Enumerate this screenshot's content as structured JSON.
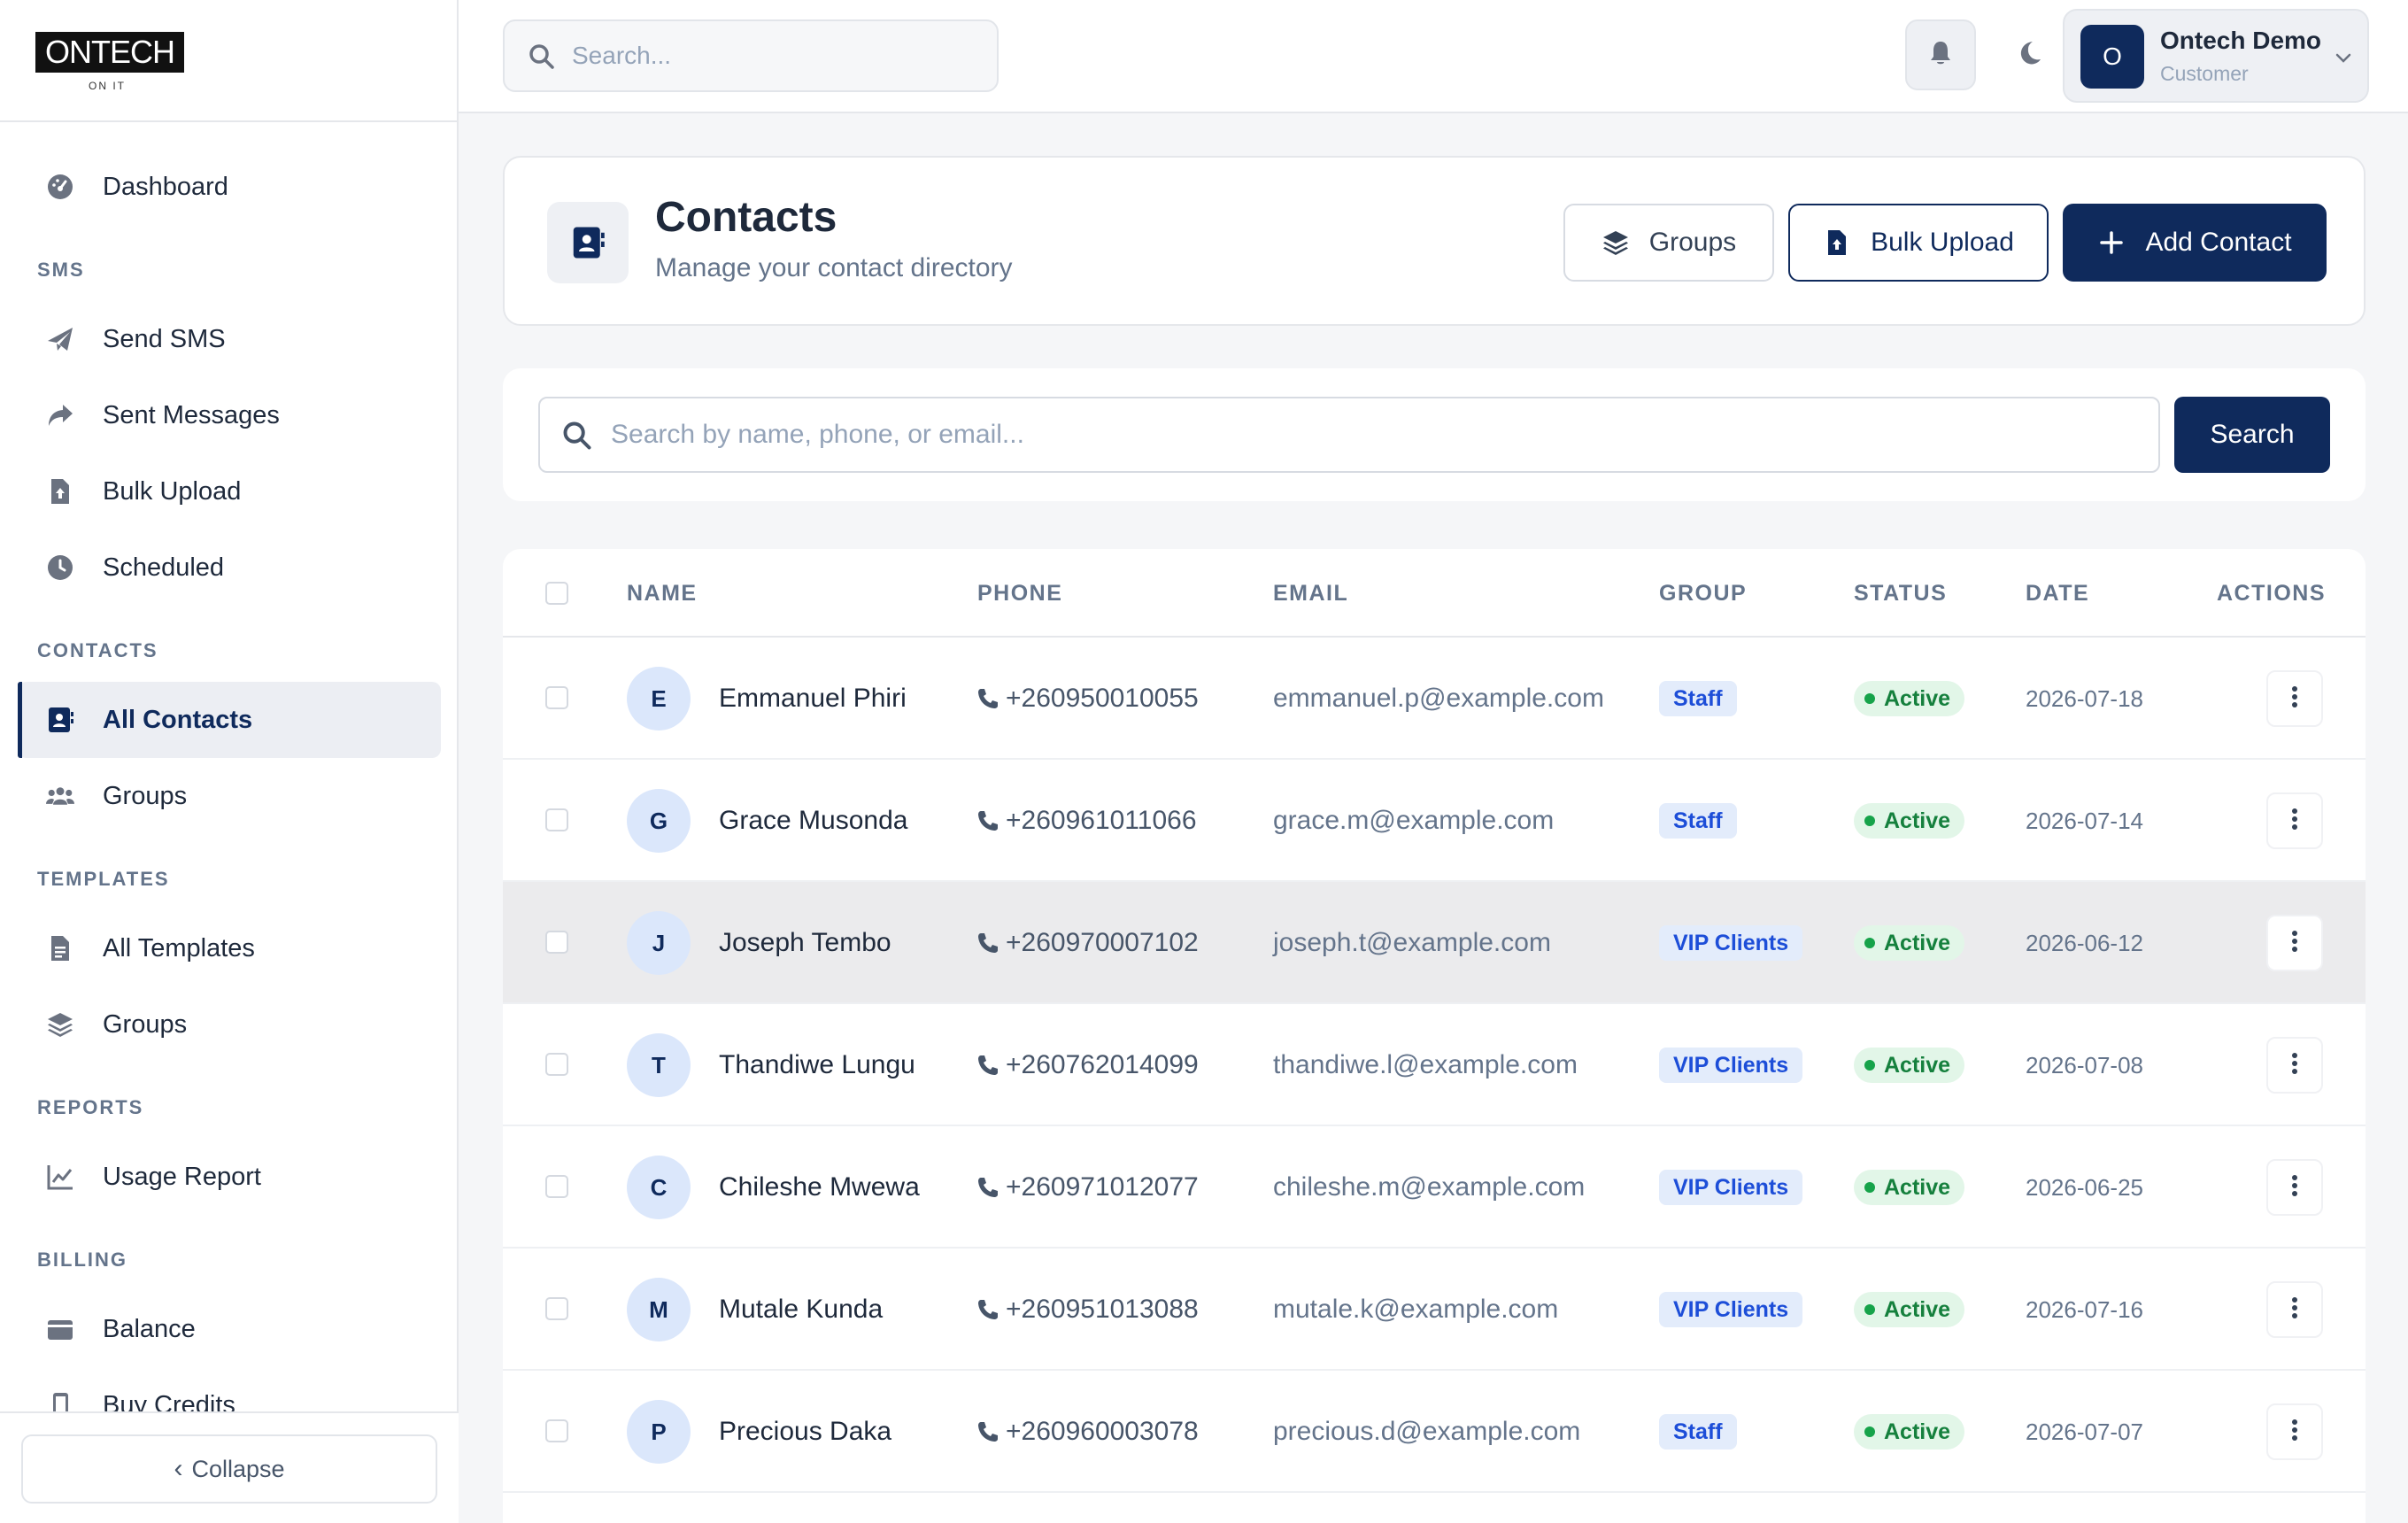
{
  "brand": {
    "logo_text": "ONTECH",
    "tagline": "ON IT"
  },
  "topbar": {
    "search_placeholder": "Search...",
    "user": {
      "initial": "O",
      "name": "Ontech Demo",
      "role": "Customer"
    }
  },
  "sidebar": {
    "dashboard": "Dashboard",
    "sections": {
      "sms": "SMS",
      "contacts": "CONTACTS",
      "templates": "TEMPLATES",
      "reports": "REPORTS",
      "billing": "BILLING"
    },
    "items": {
      "send_sms": "Send SMS",
      "sent_messages": "Sent Messages",
      "bulk_upload": "Bulk Upload",
      "scheduled": "Scheduled",
      "all_contacts": "All Contacts",
      "contact_groups": "Groups",
      "all_templates": "All Templates",
      "template_groups": "Groups",
      "usage_report": "Usage Report",
      "balance": "Balance",
      "buy_credits": "Buy Credits"
    },
    "collapse": "Collapse",
    "active": "all_contacts"
  },
  "page": {
    "title": "Contacts",
    "subtitle": "Manage your contact directory",
    "buttons": {
      "groups": "Groups",
      "bulk_upload": "Bulk Upload",
      "add_contact": "Add Contact"
    }
  },
  "search": {
    "placeholder": "Search by name, phone, or email...",
    "button": "Search"
  },
  "table": {
    "columns": {
      "name": "NAME",
      "phone": "PHONE",
      "email": "EMAIL",
      "group": "GROUP",
      "status": "STATUS",
      "date": "DATE",
      "actions": "ACTIONS"
    },
    "rows": [
      {
        "initial": "E",
        "name": "Emmanuel Phiri",
        "phone": "+260950010055",
        "email": "emmanuel.p@example.com",
        "group": "Staff",
        "status": "Active",
        "date": "2026-07-18"
      },
      {
        "initial": "G",
        "name": "Grace Musonda",
        "phone": "+260961011066",
        "email": "grace.m@example.com",
        "group": "Staff",
        "status": "Active",
        "date": "2026-07-14"
      },
      {
        "initial": "J",
        "name": "Joseph Tembo",
        "phone": "+260970007102",
        "email": "joseph.t@example.com",
        "group": "VIP Clients",
        "status": "Active",
        "date": "2026-06-12"
      },
      {
        "initial": "T",
        "name": "Thandiwe Lungu",
        "phone": "+260762014099",
        "email": "thandiwe.l@example.com",
        "group": "VIP Clients",
        "status": "Active",
        "date": "2026-07-08"
      },
      {
        "initial": "C",
        "name": "Chileshe Mwewa",
        "phone": "+260971012077",
        "email": "chileshe.m@example.com",
        "group": "VIP Clients",
        "status": "Active",
        "date": "2026-06-25"
      },
      {
        "initial": "M",
        "name": "Mutale Kunda",
        "phone": "+260951013088",
        "email": "mutale.k@example.com",
        "group": "VIP Clients",
        "status": "Active",
        "date": "2026-07-16"
      },
      {
        "initial": "P",
        "name": "Precious Daka",
        "phone": "+260960003078",
        "email": "precious.d@example.com",
        "group": "Staff",
        "status": "Active",
        "date": "2026-07-07"
      }
    ]
  },
  "colors": {
    "primary": "#0f2a5c",
    "active_green": "#16a34a",
    "group_blue": "#1d4ed8"
  }
}
